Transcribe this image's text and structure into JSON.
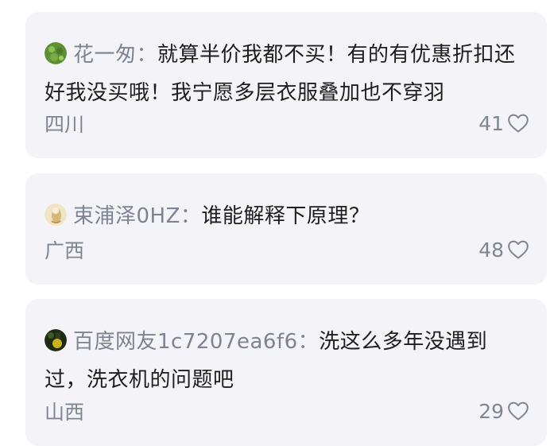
{
  "comments": [
    {
      "username": "花一匆",
      "separator": "：",
      "content": "就算半价我都不买！有的有优惠折扣还好我没买哦！我宁愿多层衣服叠加也不穿羽",
      "location": "四川",
      "likes": "41",
      "avatar_color": "#6a9a3a"
    },
    {
      "username": "束浦泽0HZ",
      "separator": "：",
      "content": "谁能解释下原理？",
      "location": "广西",
      "likes": "48",
      "avatar_color": "#e8d8a8"
    },
    {
      "username": "百度网友1c7207ea6f6",
      "separator": "：",
      "content": "洗这么多年没遇到过，洗衣机的问题吧",
      "location": "山西",
      "likes": "29",
      "avatar_color": "#2a3a1a"
    }
  ],
  "icons": {
    "like": "heart-outline-icon"
  }
}
